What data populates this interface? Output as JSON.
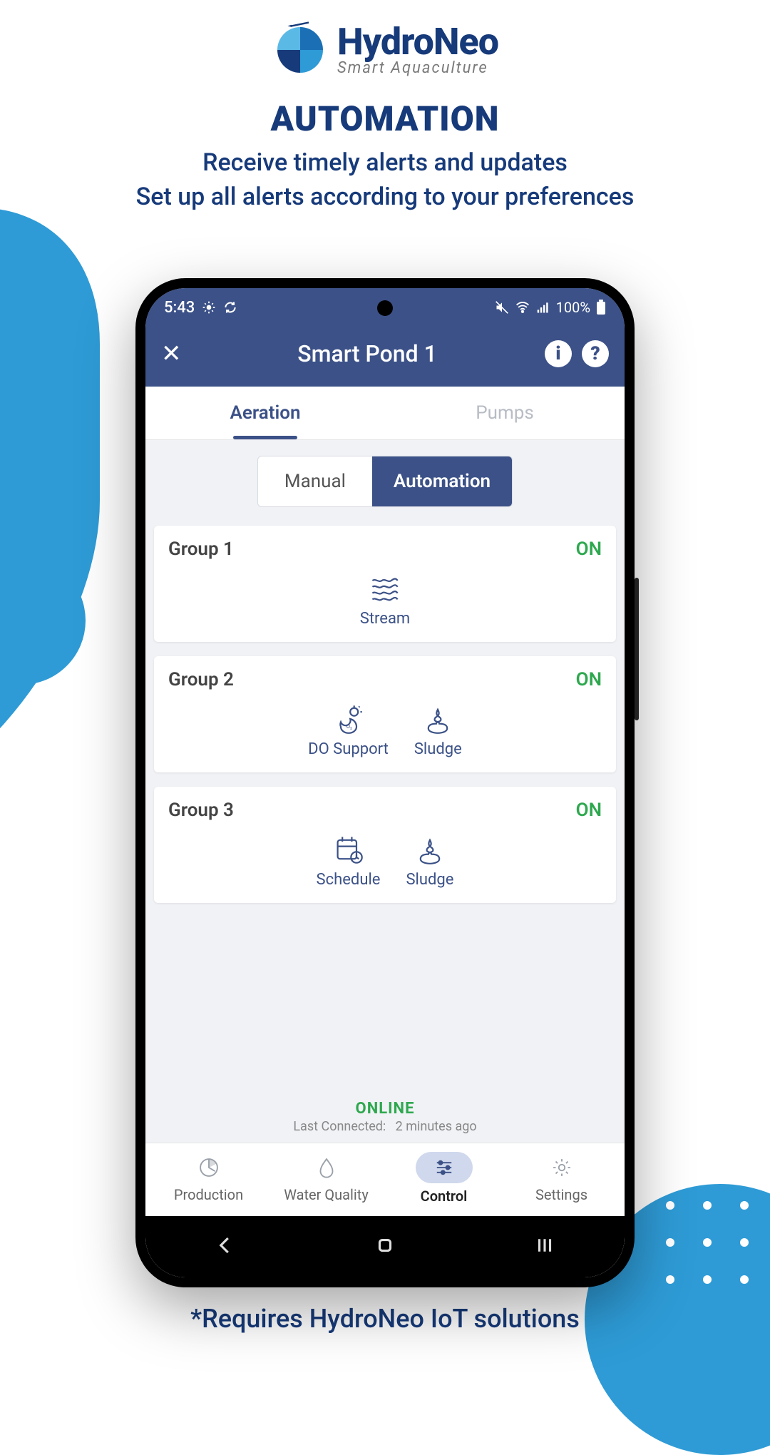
{
  "brand": {
    "name": "HydroNeo",
    "tagline": "Smart Aquaculture"
  },
  "promo": {
    "title": "AUTOMATION",
    "line1": "Receive timely alerts and updates",
    "line2": "Set up all alerts according to your preferences",
    "footnote": "*Requires HydroNeo IoT solutions"
  },
  "statusbar": {
    "time": "5:43",
    "battery": "100%"
  },
  "app": {
    "title": "Smart Pond 1",
    "tabs": {
      "aeration": "Aeration",
      "pumps": "Pumps"
    },
    "modes": {
      "manual": "Manual",
      "automation": "Automation"
    },
    "groups": [
      {
        "name": "Group 1",
        "state": "ON",
        "features": [
          {
            "icon": "stream",
            "label": "Stream"
          }
        ]
      },
      {
        "name": "Group 2",
        "state": "ON",
        "features": [
          {
            "icon": "do-support",
            "label": "DO Support"
          },
          {
            "icon": "sludge",
            "label": "Sludge"
          }
        ]
      },
      {
        "name": "Group 3",
        "state": "ON",
        "features": [
          {
            "icon": "schedule",
            "label": "Schedule"
          },
          {
            "icon": "sludge",
            "label": "Sludge"
          }
        ]
      }
    ],
    "online_status": "ONLINE",
    "last_connected_label": "Last Connected:",
    "last_connected_value": "2 minutes ago",
    "nav": {
      "production": "Production",
      "water_quality": "Water Quality",
      "control": "Control",
      "settings": "Settings"
    }
  }
}
